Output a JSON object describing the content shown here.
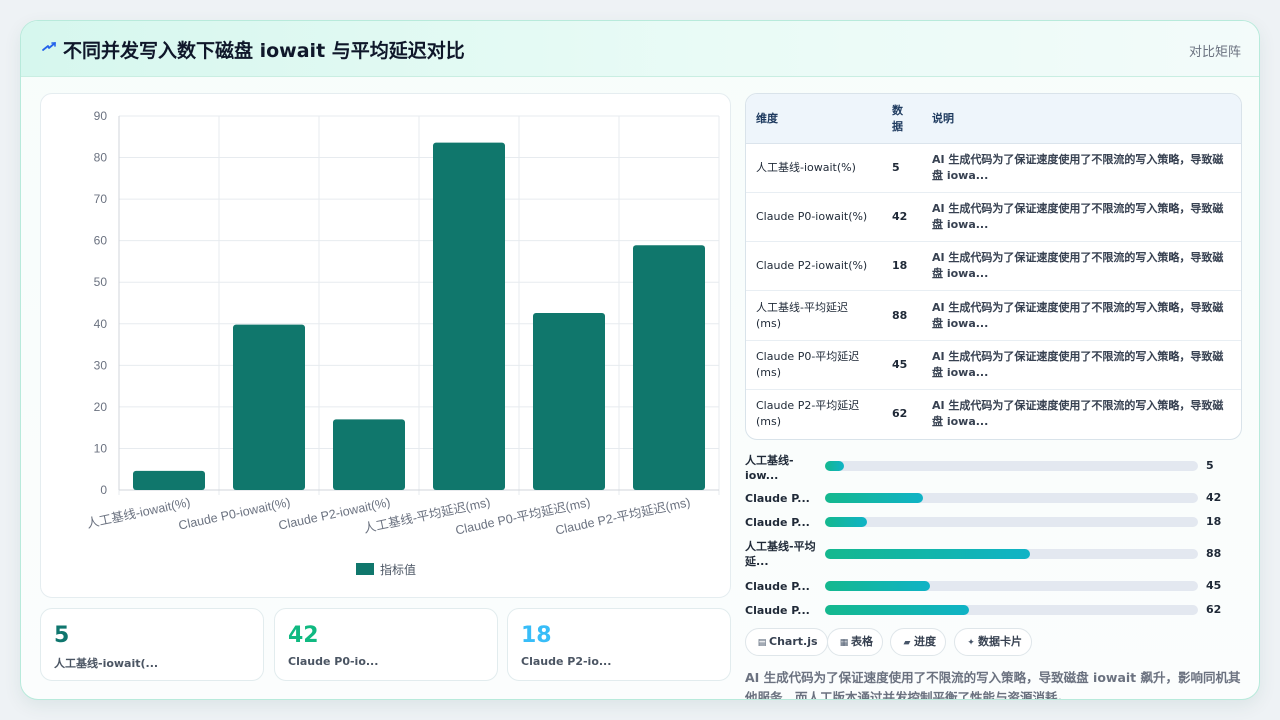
{
  "header": {
    "icon": "bolt-icon",
    "title": "不同并发写入数下磁盘 iowait 与平均延迟对比",
    "tag": "对比矩阵"
  },
  "chart_data": {
    "type": "bar",
    "categories": [
      "人工基线-iowait(%)",
      "Claude P0-iowait(%)",
      "Claude P2-iowait(%)",
      "人工基线-平均延迟(ms)",
      "Claude P0-平均延迟(ms)",
      "Claude P2-平均延迟(ms)"
    ],
    "series": [
      {
        "name": "指标值",
        "values": [
          4.6,
          39.8,
          17,
          83.6,
          42.6,
          58.9
        ]
      }
    ],
    "ylim": [
      0,
      90
    ],
    "yticks": [
      0,
      10,
      20,
      30,
      40,
      50,
      60,
      70,
      80,
      90
    ],
    "grid": true,
    "legend_position": "bottom",
    "bar_color": "#10776c"
  },
  "stats": [
    {
      "value": "5",
      "label": "人工基线-iowait(...",
      "color": "#0f766e"
    },
    {
      "value": "42",
      "label": "Claude P0-io...",
      "color": "#10b981"
    },
    {
      "value": "18",
      "label": "Claude P2-io...",
      "color": "#38bdf8"
    }
  ],
  "table": {
    "headers": [
      "维度",
      "数据",
      "说明"
    ],
    "rows": [
      {
        "dim": "人工基线-iowait(%)",
        "num": "5",
        "desc": "AI 生成代码为了保证速度使用了不限流的写入策略，导致磁盘 iowa..."
      },
      {
        "dim": "Claude P0-iowait(%)",
        "num": "42",
        "desc": "AI 生成代码为了保证速度使用了不限流的写入策略，导致磁盘 iowa..."
      },
      {
        "dim": "Claude P2-iowait(%)",
        "num": "18",
        "desc": "AI 生成代码为了保证速度使用了不限流的写入策略，导致磁盘 iowa..."
      },
      {
        "dim": "人工基线-平均延迟(ms)",
        "num": "88",
        "desc": "AI 生成代码为了保证速度使用了不限流的写入策略，导致磁盘 iowa..."
      },
      {
        "dim": "Claude P0-平均延迟(ms)",
        "num": "45",
        "desc": "AI 生成代码为了保证速度使用了不限流的写入策略，导致磁盘 iowa..."
      },
      {
        "dim": "Claude P2-平均延迟(ms)",
        "num": "62",
        "desc": "AI 生成代码为了保证速度使用了不限流的写入策略，导致磁盘 iowa..."
      }
    ]
  },
  "progress": [
    {
      "label": "人工基线-iow...",
      "value": "5",
      "fraction": 0.05
    },
    {
      "label": "Claude P...",
      "value": "42",
      "fraction": 0.262
    },
    {
      "label": "Claude P...",
      "value": "18",
      "fraction": 0.112
    },
    {
      "label": "人工基线-平均延...",
      "value": "88",
      "fraction": 0.55
    },
    {
      "label": "Claude P...",
      "value": "45",
      "fraction": 0.281
    },
    {
      "label": "Claude P...",
      "value": "62",
      "fraction": 0.387
    }
  ],
  "chips": [
    {
      "icon": "chart-icon",
      "label": "Chart.js"
    },
    {
      "icon": "table-icon",
      "label": "表格"
    },
    {
      "icon": "progress-icon",
      "label": "进度"
    },
    {
      "icon": "sparkle-icon",
      "label": "数据卡片"
    }
  ],
  "summary": "AI 生成代码为了保证速度使用了不限流的写入策略，导致磁盘 iowait 飙升，影响同机其他服务，而人工版本通过并发控制平衡了性能与资源消耗。"
}
